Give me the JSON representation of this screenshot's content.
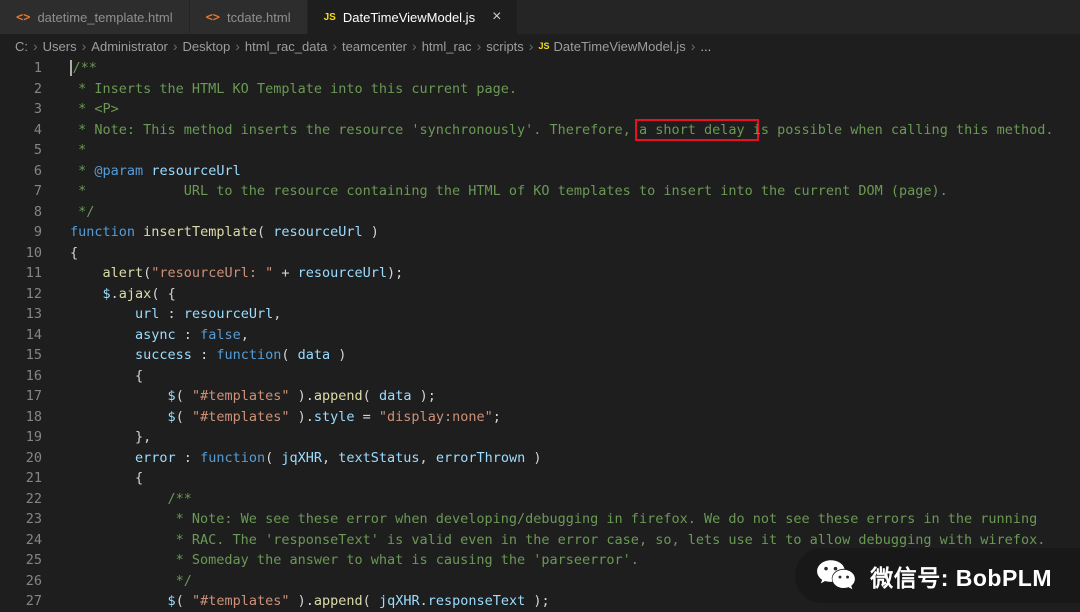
{
  "tabs": [
    {
      "label": "datetime_template.html",
      "icon": "<>",
      "type": "html",
      "active": false
    },
    {
      "label": "tcdate.html",
      "icon": "<>",
      "type": "html",
      "active": false
    },
    {
      "label": "DateTimeViewModel.js",
      "icon": "JS",
      "type": "js",
      "active": true,
      "close": "×"
    }
  ],
  "breadcrumb": {
    "separator": "›",
    "items": [
      {
        "label": "C:"
      },
      {
        "label": "Users"
      },
      {
        "label": "Administrator"
      },
      {
        "label": "Desktop"
      },
      {
        "label": "html_rac_data"
      },
      {
        "label": "teamcenter"
      },
      {
        "label": "html_rac"
      },
      {
        "label": "scripts"
      },
      {
        "label": "DateTimeViewModel.js",
        "icon": "JS"
      },
      {
        "label": "..."
      }
    ]
  },
  "editor": {
    "colors": {
      "comment": "#6a9955",
      "keyword": "#569cd6",
      "func": "#dcdcaa",
      "string": "#ce9178",
      "variable": "#9cdcfe",
      "plain": "#d4d4d4",
      "lineNumber": "#858585",
      "highlight": "#e81123"
    },
    "lines": [
      {
        "n": 1,
        "cursor": true,
        "tk": [
          {
            "t": "comment",
            "x": "/**"
          }
        ]
      },
      {
        "n": 2,
        "tk": [
          {
            "t": "comment",
            "x": " * Inserts the HTML KO Template into this current page."
          }
        ]
      },
      {
        "n": 3,
        "tk": [
          {
            "t": "comment",
            "x": " * <P>"
          }
        ]
      },
      {
        "n": 4,
        "tk": [
          {
            "t": "comment",
            "x": " * Note: This method inserts the resource 'synchronously'. Therefore, "
          },
          {
            "t": "comment",
            "x": "a short delay",
            "hl": true
          },
          {
            "t": "comment",
            "x": " is possible when calling this method."
          }
        ]
      },
      {
        "n": 5,
        "tk": [
          {
            "t": "comment",
            "x": " *"
          }
        ]
      },
      {
        "n": 6,
        "tk": [
          {
            "t": "comment",
            "x": " * "
          },
          {
            "t": "keyword",
            "x": "@param"
          },
          {
            "t": "comment",
            "x": " "
          },
          {
            "t": "variable",
            "x": "resourceUrl"
          }
        ]
      },
      {
        "n": 7,
        "tk": [
          {
            "t": "comment",
            "x": " *            URL to the resource containing the HTML of KO templates to insert into the current DOM (page)."
          }
        ]
      },
      {
        "n": 8,
        "tk": [
          {
            "t": "comment",
            "x": " */"
          }
        ]
      },
      {
        "n": 9,
        "tk": [
          {
            "t": "keyword",
            "x": "function"
          },
          {
            "t": "plain",
            "x": " "
          },
          {
            "t": "func",
            "x": "insertTemplate"
          },
          {
            "t": "plain",
            "x": "( "
          },
          {
            "t": "variable",
            "x": "resourceUrl"
          },
          {
            "t": "plain",
            "x": " )"
          }
        ]
      },
      {
        "n": 10,
        "tk": [
          {
            "t": "plain",
            "x": "{"
          }
        ]
      },
      {
        "n": 11,
        "tk": [
          {
            "t": "plain",
            "x": "    "
          },
          {
            "t": "func",
            "x": "alert"
          },
          {
            "t": "plain",
            "x": "("
          },
          {
            "t": "string",
            "x": "\"resourceUrl: \""
          },
          {
            "t": "plain",
            "x": " + "
          },
          {
            "t": "variable",
            "x": "resourceUrl"
          },
          {
            "t": "plain",
            "x": ");"
          }
        ]
      },
      {
        "n": 12,
        "tk": [
          {
            "t": "plain",
            "x": "    "
          },
          {
            "t": "variable",
            "x": "$"
          },
          {
            "t": "plain",
            "x": "."
          },
          {
            "t": "func",
            "x": "ajax"
          },
          {
            "t": "plain",
            "x": "( {"
          }
        ]
      },
      {
        "n": 13,
        "tk": [
          {
            "t": "plain",
            "x": "        "
          },
          {
            "t": "variable",
            "x": "url"
          },
          {
            "t": "plain",
            "x": " : "
          },
          {
            "t": "variable",
            "x": "resourceUrl"
          },
          {
            "t": "plain",
            "x": ","
          }
        ]
      },
      {
        "n": 14,
        "tk": [
          {
            "t": "plain",
            "x": "        "
          },
          {
            "t": "variable",
            "x": "async"
          },
          {
            "t": "plain",
            "x": " : "
          },
          {
            "t": "keyword",
            "x": "false"
          },
          {
            "t": "plain",
            "x": ","
          }
        ]
      },
      {
        "n": 15,
        "tk": [
          {
            "t": "plain",
            "x": "        "
          },
          {
            "t": "variable",
            "x": "success"
          },
          {
            "t": "plain",
            "x": " : "
          },
          {
            "t": "keyword",
            "x": "function"
          },
          {
            "t": "plain",
            "x": "( "
          },
          {
            "t": "variable",
            "x": "data"
          },
          {
            "t": "plain",
            "x": " )"
          }
        ]
      },
      {
        "n": 16,
        "tk": [
          {
            "t": "plain",
            "x": "        {"
          }
        ]
      },
      {
        "n": 17,
        "tk": [
          {
            "t": "plain",
            "x": "            "
          },
          {
            "t": "variable",
            "x": "$"
          },
          {
            "t": "plain",
            "x": "( "
          },
          {
            "t": "string",
            "x": "\"#templates\""
          },
          {
            "t": "plain",
            "x": " )."
          },
          {
            "t": "func",
            "x": "append"
          },
          {
            "t": "plain",
            "x": "( "
          },
          {
            "t": "variable",
            "x": "data"
          },
          {
            "t": "plain",
            "x": " );"
          }
        ]
      },
      {
        "n": 18,
        "tk": [
          {
            "t": "plain",
            "x": "            "
          },
          {
            "t": "variable",
            "x": "$"
          },
          {
            "t": "plain",
            "x": "( "
          },
          {
            "t": "string",
            "x": "\"#templates\""
          },
          {
            "t": "plain",
            "x": " )."
          },
          {
            "t": "variable",
            "x": "style"
          },
          {
            "t": "plain",
            "x": " = "
          },
          {
            "t": "string",
            "x": "\"display:none\""
          },
          {
            "t": "plain",
            "x": ";"
          }
        ]
      },
      {
        "n": 19,
        "tk": [
          {
            "t": "plain",
            "x": "        },"
          }
        ]
      },
      {
        "n": 20,
        "tk": [
          {
            "t": "plain",
            "x": "        "
          },
          {
            "t": "variable",
            "x": "error"
          },
          {
            "t": "plain",
            "x": " : "
          },
          {
            "t": "keyword",
            "x": "function"
          },
          {
            "t": "plain",
            "x": "( "
          },
          {
            "t": "variable",
            "x": "jqXHR"
          },
          {
            "t": "plain",
            "x": ", "
          },
          {
            "t": "variable",
            "x": "textStatus"
          },
          {
            "t": "plain",
            "x": ", "
          },
          {
            "t": "variable",
            "x": "errorThrown"
          },
          {
            "t": "plain",
            "x": " )"
          }
        ]
      },
      {
        "n": 21,
        "tk": [
          {
            "t": "plain",
            "x": "        {"
          }
        ]
      },
      {
        "n": 22,
        "tk": [
          {
            "t": "comment",
            "x": "            /**"
          }
        ]
      },
      {
        "n": 23,
        "tk": [
          {
            "t": "comment",
            "x": "             * Note: We see these error when developing/debugging in firefox. We do not see these errors in the running"
          }
        ]
      },
      {
        "n": 24,
        "tk": [
          {
            "t": "comment",
            "x": "             * RAC. The 'responseText' is valid even in the error case, so, lets use it to allow debugging with wirefox."
          }
        ]
      },
      {
        "n": 25,
        "tk": [
          {
            "t": "comment",
            "x": "             * Someday the answer to what is causing the 'parseerror'."
          }
        ]
      },
      {
        "n": 26,
        "tk": [
          {
            "t": "comment",
            "x": "             */"
          }
        ]
      },
      {
        "n": 27,
        "tk": [
          {
            "t": "plain",
            "x": "            "
          },
          {
            "t": "variable",
            "x": "$"
          },
          {
            "t": "plain",
            "x": "( "
          },
          {
            "t": "string",
            "x": "\"#templates\""
          },
          {
            "t": "plain",
            "x": " )."
          },
          {
            "t": "func",
            "x": "append"
          },
          {
            "t": "plain",
            "x": "( "
          },
          {
            "t": "variable",
            "x": "jqXHR"
          },
          {
            "t": "plain",
            "x": "."
          },
          {
            "t": "variable",
            "x": "responseText"
          },
          {
            "t": "plain",
            "x": " );"
          }
        ]
      }
    ]
  },
  "watermark": {
    "label": "微信号: BobPLM"
  }
}
